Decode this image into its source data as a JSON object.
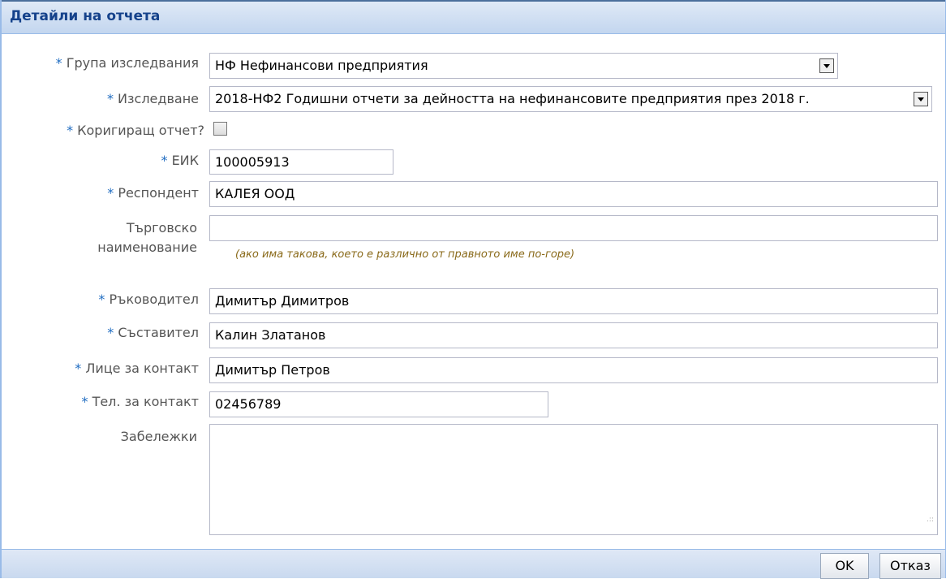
{
  "window": {
    "title": "Детайли на отчета"
  },
  "form": {
    "required_mark": "*",
    "group": {
      "label": "Група изследвания",
      "value": "НФ Нефинансови предприятия"
    },
    "survey": {
      "label": "Изследване",
      "value": "2018-НФ2 Годишни отчети за дейността на нефинансовите предприятия през 2018 г."
    },
    "correcting": {
      "label": "Коригиращ отчет?",
      "checked": false
    },
    "eik": {
      "label": "ЕИК",
      "value": "100005913"
    },
    "respondent": {
      "label": "Респондент",
      "value": "КАЛЕЯ ООД"
    },
    "trade_name": {
      "label_line1": "Търговско",
      "label_line2": "наименование",
      "value": "",
      "hint": "(ако има такова, което е различно от правното име по-горе)"
    },
    "manager": {
      "label": "Ръководител",
      "value": "Димитър Димитров"
    },
    "compiler": {
      "label": "Съставител",
      "value": "Калин Златанов"
    },
    "contact_person": {
      "label": "Лице за контакт",
      "value": "Димитър Петров"
    },
    "contact_phone": {
      "label": "Тел. за контакт",
      "value": "02456789"
    },
    "notes": {
      "label": "Забележки",
      "value": ""
    }
  },
  "footer": {
    "ok_label": "OK",
    "cancel_label": "Отказ"
  },
  "colors": {
    "required": "#1f6cc1",
    "header_text": "#15428b",
    "hint": "#8a6a1a"
  }
}
